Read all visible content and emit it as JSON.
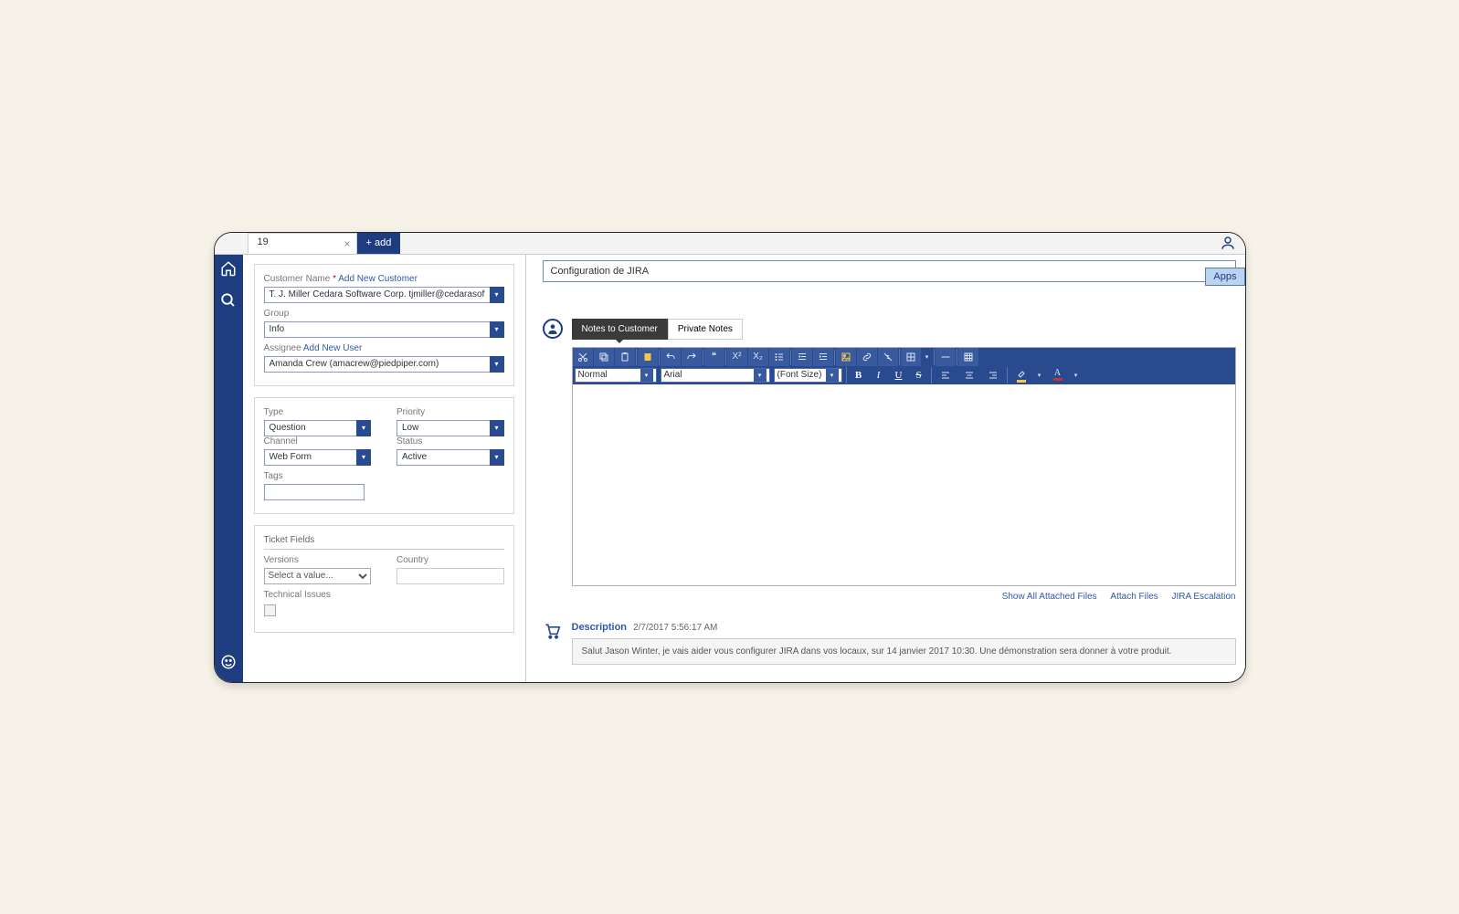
{
  "tabs": {
    "open": "19",
    "add": "+ add"
  },
  "left": {
    "customer_label": "Customer Name",
    "add_new_customer": "Add New Customer",
    "customer_value": "T. J. Miller Cedara Software Corp. tjmiller@cedarasoftware.com",
    "group_label": "Group",
    "group_value": "Info",
    "assignee_label": "Assignee",
    "add_new_user": "Add New User",
    "assignee_value": "Amanda Crew (amacrew@piedpiper.com)",
    "type_label": "Type",
    "type_value": "Question",
    "priority_label": "Priority",
    "priority_value": "Low",
    "channel_label": "Channel",
    "channel_value": "Web Form",
    "status_label": "Status",
    "status_value": "Active",
    "tags_label": "Tags",
    "ticket_fields_header": "Ticket Fields",
    "versions_label": "Versions",
    "versions_value": "Select a value...",
    "country_label": "Country",
    "technical_issues_label": "Technical Issues"
  },
  "right": {
    "subject": "Configuration de JIRA",
    "apps_btn": "Apps",
    "notes_tab_customer": "Notes to Customer",
    "notes_tab_private": "Private Notes",
    "format_normal": "Normal",
    "format_font": "Arial",
    "format_size": "(Font Size)",
    "show_attached": "Show All Attached Files",
    "attach_files": "Attach Files",
    "jira_escalation": "JIRA Escalation",
    "desc_title": "Description",
    "desc_date": "2/7/2017 5:56:17 AM",
    "desc_body": "Salut Jason Winter, je vais aider vous configurer JIRA dans vos locaux, sur 14 janvier 2017 10:30. Une démonstration sera donner à votre produit."
  }
}
